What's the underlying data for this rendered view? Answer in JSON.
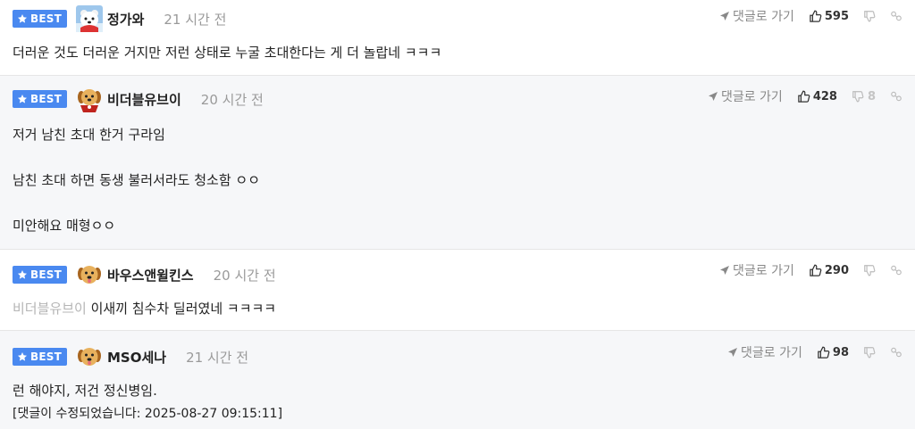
{
  "comments": [
    {
      "badge": "BEST",
      "avatar": "polar-bear-avatar",
      "nickname": "정가와",
      "time": "21 시간 전",
      "reply_label": "댓글로 가기",
      "likes": "595",
      "dislikes": "",
      "lines": [
        "더러운 것도 더러운 거지만 저런 상태로 누굴 초대한다는 게 더 놀랍네 ㅋㅋㅋ"
      ]
    },
    {
      "badge": "BEST",
      "avatar": "puppy-red-scarf-avatar",
      "nickname": "비더블유브이",
      "time": "20 시간 전",
      "reply_label": "댓글로 가기",
      "likes": "428",
      "dislikes": "8",
      "lines": [
        "저거 남친 초대 한거 구라임",
        "남친 초대 하면 동생 불러서라도 청소함 ㅇㅇ",
        "미안해요 매형ㅇㅇ"
      ]
    },
    {
      "badge": "BEST",
      "avatar": "puppy-avatar",
      "nickname": "바우스앤윌킨스",
      "time": "20 시간 전",
      "reply_label": "댓글로 가기",
      "likes": "290",
      "dislikes": "",
      "mention": "비더블유브이",
      "lines": [
        "이새끼 침수차 딜러였네 ㅋㅋㅋㅋ"
      ]
    },
    {
      "badge": "BEST",
      "avatar": "puppy-avatar",
      "nickname": "MSO세나",
      "time": "21 시간 전",
      "reply_label": "댓글로 가기",
      "likes": "98",
      "dislikes": "",
      "lines": [
        "런 해야지, 저건 정신병임.",
        "[댓글이 수정되었습니다: 2025-08-27 09:15:11]"
      ]
    }
  ],
  "colors": {
    "badge": "#4a89f0",
    "shaded_bg": "#f6f7f9",
    "muted": "#9a9a9a",
    "mention": "#b5b5b5"
  }
}
